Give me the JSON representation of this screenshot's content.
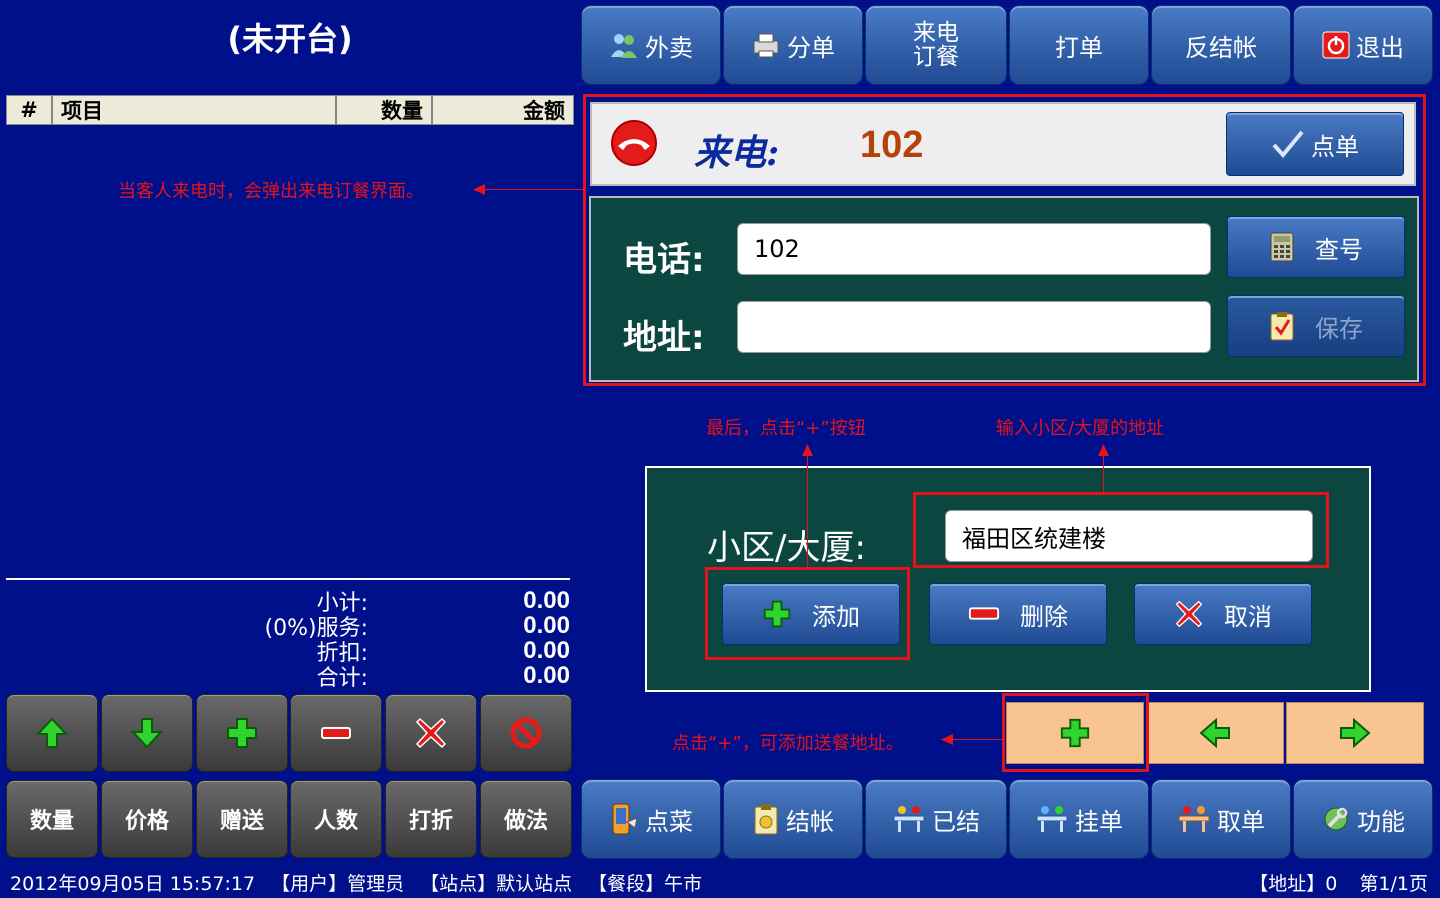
{
  "left": {
    "title": "(未开台)",
    "columns": [
      "#",
      "项目",
      "数量",
      "金额"
    ],
    "totals": [
      {
        "label": "小计:",
        "value": "0.00"
      },
      {
        "label": "(0%)服务:",
        "value": "0.00"
      },
      {
        "label": "折扣:",
        "value": "0.00"
      },
      {
        "label": "合计:",
        "value": "0.00"
      }
    ],
    "icon_buttons": [
      "arrow-up-icon",
      "arrow-down-icon",
      "plus-icon",
      "minus-icon",
      "delete-x-icon",
      "forbid-icon"
    ],
    "action_buttons": [
      "数量",
      "价格",
      "赠送",
      "人数",
      "打折",
      "做法"
    ]
  },
  "top_buttons": [
    {
      "label": "外卖",
      "icon": "users-icon"
    },
    {
      "label": "分单",
      "icon": "printer-icon"
    },
    {
      "label_line1": "来电",
      "label_line2": "订餐"
    },
    {
      "label": "打单"
    },
    {
      "label": "反结帐"
    },
    {
      "label": "退出",
      "icon": "power-icon"
    }
  ],
  "caller": {
    "label": "来电:",
    "number": "102",
    "order_button": "点单"
  },
  "phone_form": {
    "phone_label": "电话:",
    "phone_value": "102",
    "address_label": "地址:",
    "address_value": "",
    "lookup_button": "查号",
    "save_button": "保存"
  },
  "community": {
    "label": "小区/大厦:",
    "value": "福田区统建楼",
    "add_button": "添加",
    "delete_button": "删除",
    "cancel_button": "取消"
  },
  "bottom_buttons": [
    {
      "label": "点菜",
      "icon": "phone-menu-icon"
    },
    {
      "label": "结帐",
      "icon": "clipboard-coin-icon"
    },
    {
      "label": "已结",
      "icon": "table-done-icon"
    },
    {
      "label": "挂单",
      "icon": "table-pending-icon"
    },
    {
      "label": "取单",
      "icon": "table-take-icon"
    },
    {
      "label": "功能",
      "icon": "tools-icon"
    }
  ],
  "annotations": {
    "popup_note": "当客人来电时，会弹出来电订餐界面。",
    "click_plus_note": "最后，点击“+”按钮",
    "input_note": "输入小区/大厦的地址",
    "add_address_note": "点击“+”，可添加送餐地址。"
  },
  "status": {
    "datetime": "2012年09月05日 15:57:17",
    "user": "【用户】管理员",
    "station": "【站点】默认站点",
    "period": "【餐段】午市",
    "address_count": "【地址】0",
    "page": "第1/1页"
  },
  "colors": {
    "background": "#000f8a",
    "panel_green": "#0c4640",
    "highlight_red": "#e4131b",
    "caller_number": "#b5410c",
    "orange_nav": "#f8c591"
  }
}
